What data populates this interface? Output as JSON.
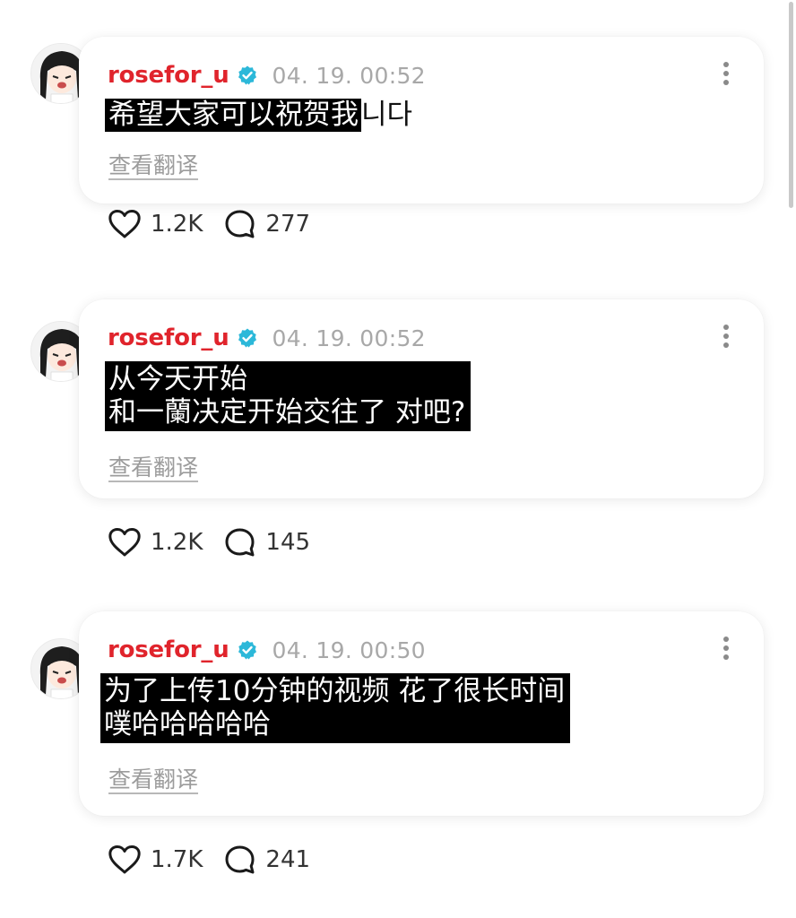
{
  "colors": {
    "username": "#e0242c",
    "verified_badge": "#2cb8d9",
    "highlight_bg": "#000000",
    "timestamp": "#a8a8a8"
  },
  "icons": {
    "like": "heart-icon",
    "comment": "comment-bubble-icon",
    "verified": "verified-badge-icon",
    "more": "more-vertical-icon"
  },
  "posts": [
    {
      "username": "rosefor_u",
      "timestamp": "04. 19. 00:52",
      "highlighted_text": "希望大家可以祝贺我",
      "trailing_text": "니다",
      "translate_label": "查看翻译",
      "likes": "1.2K",
      "comments": "277"
    },
    {
      "username": "rosefor_u",
      "timestamp": "04. 19. 00:52",
      "highlighted_lines": [
        "从今天开始",
        "和一蘭决定开始交往了 对吧?"
      ],
      "translate_label": "查看翻译",
      "likes": "1.2K",
      "comments": "145"
    },
    {
      "username": "rosefor_u",
      "timestamp": "04. 19. 00:50",
      "highlighted_lines": [
        "为了上传10分钟的视频 花了很长时间",
        "噗哈哈哈哈哈"
      ],
      "translate_label": "查看翻译",
      "likes": "1.7K",
      "comments": "241"
    }
  ]
}
